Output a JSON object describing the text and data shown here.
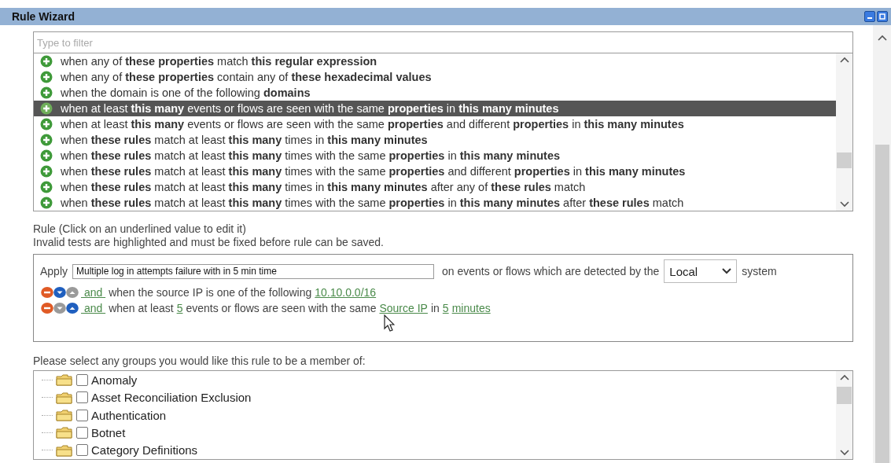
{
  "window": {
    "title": "Rule Wizard"
  },
  "filter": {
    "placeholder": "Type to filter"
  },
  "tests": [
    {
      "text": "when any of **these properties** match **this regular expression**",
      "selected": false
    },
    {
      "text": "when any of **these properties** contain any of **these hexadecimal values**",
      "selected": false
    },
    {
      "text": "when the domain is one of the following **domains**",
      "selected": false
    },
    {
      "text": "when at least **this many** events or flows are seen with the same **properties** in **this many minutes**",
      "selected": true
    },
    {
      "text": "when at least **this many** events or flows are seen with the same **properties** and different **properties** in **this many minutes**",
      "selected": false
    },
    {
      "text": "when **these rules** match at least **this many** times in **this many minutes**",
      "selected": false
    },
    {
      "text": "when **these rules** match at least **this many** times with the same **properties** in **this many minutes**",
      "selected": false
    },
    {
      "text": "when **these rules** match at least **this many** times with the same **properties** and different **properties** in **this many minutes**",
      "selected": false
    },
    {
      "text": "when **these rules** match at least **this many** times in **this many minutes** after any of **these rules** match",
      "selected": false
    },
    {
      "text": "when **these rules** match at least **this many** times with the same **properties** in **this many minutes** after **these rules** match",
      "selected": false
    }
  ],
  "rule_help": [
    "Rule (Click on an underlined value to edit it)",
    "Invalid tests are highlighted and must be fixed before rule can be saved."
  ],
  "rule": {
    "apply_label": "Apply",
    "name": "Multiple log in attempts failure with in 5 min time",
    "detected_text": "on events or flows which are detected by the",
    "system_select": "Local",
    "system_label": "system",
    "lines": [
      {
        "buttons": [
          {
            "kind": "remove",
            "disabled": false
          },
          {
            "kind": "down",
            "disabled": false
          },
          {
            "kind": "up",
            "disabled": true
          }
        ],
        "segments": [
          {
            "kind": "link",
            "text": " and "
          },
          {
            "kind": "text",
            "text": "when the source IP is one of the following"
          },
          {
            "kind": "link",
            "text": "10.10.0.0/16"
          }
        ]
      },
      {
        "buttons": [
          {
            "kind": "remove",
            "disabled": false
          },
          {
            "kind": "down",
            "disabled": true
          },
          {
            "kind": "up",
            "disabled": false
          }
        ],
        "segments": [
          {
            "kind": "link",
            "text": " and "
          },
          {
            "kind": "text",
            "text": "when at least"
          },
          {
            "kind": "link",
            "text": "5"
          },
          {
            "kind": "text",
            "text": "events or flows are seen with the same"
          },
          {
            "kind": "link",
            "text": "Source IP"
          },
          {
            "kind": "text",
            "text": "in"
          },
          {
            "kind": "link",
            "text": "5"
          },
          {
            "kind": "link",
            "text": "minutes"
          }
        ]
      }
    ]
  },
  "groups_label": "Please select any groups you would like this rule to be a member of:",
  "groups": [
    {
      "label": "Anomaly",
      "checked": false
    },
    {
      "label": "Asset Reconciliation Exclusion",
      "checked": false
    },
    {
      "label": "Authentication",
      "checked": false
    },
    {
      "label": "Botnet",
      "checked": false
    },
    {
      "label": "Category Definitions",
      "checked": false
    }
  ]
}
